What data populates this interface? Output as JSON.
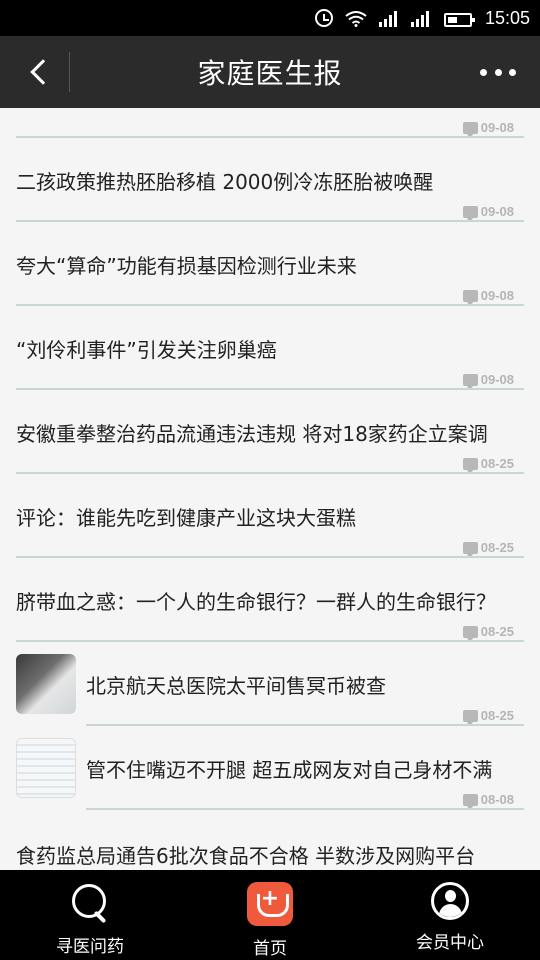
{
  "status": {
    "time": "15:05"
  },
  "header": {
    "title": "家庭医生报"
  },
  "articles": [
    {
      "title": "",
      "date": "09-08"
    },
    {
      "title": "二孩政策推热胚胎移植 2000例冷冻胚胎被唤醒",
      "date": "09-08"
    },
    {
      "title": "夸大“算命”功能有损基因检测行业未来",
      "date": "09-08"
    },
    {
      "title": "“刘伶利事件”引发关注卵巢癌",
      "date": "09-08"
    },
    {
      "title": "安徽重拳整治药品流通违法违规 将对18家药企立案调",
      "date": "08-25"
    },
    {
      "title": "评论：谁能先吃到健康产业这块大蛋糕",
      "date": "08-25"
    },
    {
      "title": "脐带血之惑：一个人的生命银行？一群人的生命银行？",
      "date": "08-25"
    },
    {
      "title": "北京航天总医院太平间售冥币被查",
      "date": "08-25"
    },
    {
      "title": "管不住嘴迈不开腿 超五成网友对自己身材不满",
      "date": "08-08"
    },
    {
      "title": "食药监总局通告6批次食品不合格 半数涉及网购平台",
      "date": ""
    }
  ],
  "tabs": [
    {
      "label": "寻医问药",
      "icon": "search-icon"
    },
    {
      "label": "首页",
      "icon": "home-icon"
    },
    {
      "label": "会员中心",
      "icon": "user-icon"
    }
  ]
}
